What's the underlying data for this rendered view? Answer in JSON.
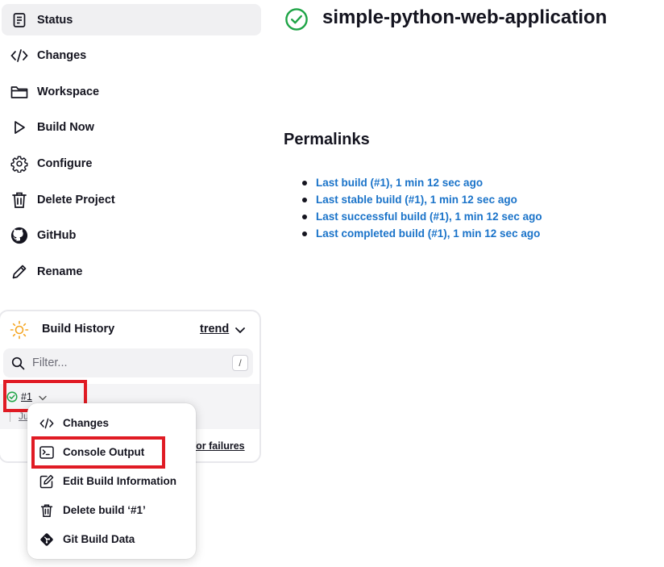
{
  "sidebar": {
    "items": [
      {
        "label": "Status",
        "icon": "status-icon"
      },
      {
        "label": "Changes",
        "icon": "code-icon"
      },
      {
        "label": "Workspace",
        "icon": "folder-icon"
      },
      {
        "label": "Build Now",
        "icon": "play-icon"
      },
      {
        "label": "Configure",
        "icon": "gear-icon"
      },
      {
        "label": "Delete Project",
        "icon": "trash-icon"
      },
      {
        "label": "GitHub",
        "icon": "github-icon"
      },
      {
        "label": "Rename",
        "icon": "pencil-icon"
      }
    ]
  },
  "build_history": {
    "title": "Build History",
    "trend_label": "trend",
    "filter": {
      "placeholder": "Filter...",
      "shortcut": "/"
    },
    "builds": [
      {
        "number": "#1",
        "date_fragment": "Ju",
        "status": "success"
      }
    ],
    "atom_link_fragment": "for failures"
  },
  "dropdown": {
    "items": [
      {
        "label": "Changes",
        "icon": "code-icon"
      },
      {
        "label": "Console Output",
        "icon": "terminal-icon"
      },
      {
        "label": "Edit Build Information",
        "icon": "edit-icon"
      },
      {
        "label": "Delete build ‘#1’",
        "icon": "trash-icon"
      },
      {
        "label": "Git Build Data",
        "icon": "git-icon"
      }
    ]
  },
  "main": {
    "project_title": "simple-python-web-application",
    "status": "success",
    "permalinks_heading": "Permalinks",
    "permalinks": [
      "Last build (#1), 1 min 12 sec ago",
      "Last stable build (#1), 1 min 12 sec ago",
      "Last successful build (#1), 1 min 12 sec ago",
      "Last completed build (#1), 1 min 12 sec ago"
    ]
  },
  "colors": {
    "success": "#1ea446",
    "link": "#1a73c9",
    "highlight": "#e01b24",
    "sun": "#f5a623"
  }
}
